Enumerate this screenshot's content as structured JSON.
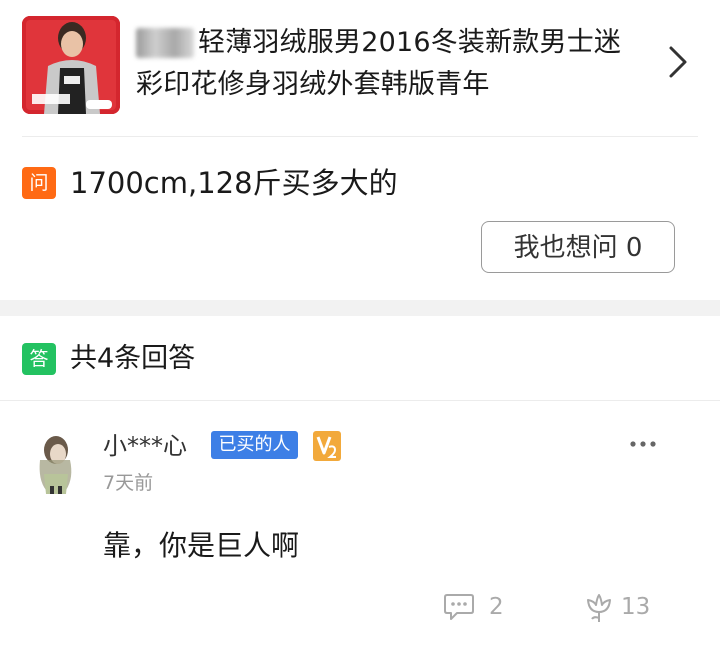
{
  "product": {
    "title": "轻薄羽绒服男2016冬装新款男士迷彩印花修身羽绒外套韩版青年",
    "thumbnail_icon": "product-photo",
    "chevron_icon": "chevron-right-icon"
  },
  "question": {
    "badge": "问",
    "text": "1700cm,128斤买多大的",
    "ask_button": "我也想问 0"
  },
  "answers": {
    "badge": "答",
    "count_label": "共4条回答",
    "items": [
      {
        "username": "小***心",
        "buyer_badge": "已买的人",
        "time": "7天前",
        "content": "靠，你是巨人啊",
        "comment_count": "2",
        "like_count": "13"
      }
    ]
  },
  "colors": {
    "question_badge": "#ff6a14",
    "answer_badge": "#23c261",
    "buyer_badge": "#3d7fe6",
    "level_badge": "#f2a93b"
  }
}
